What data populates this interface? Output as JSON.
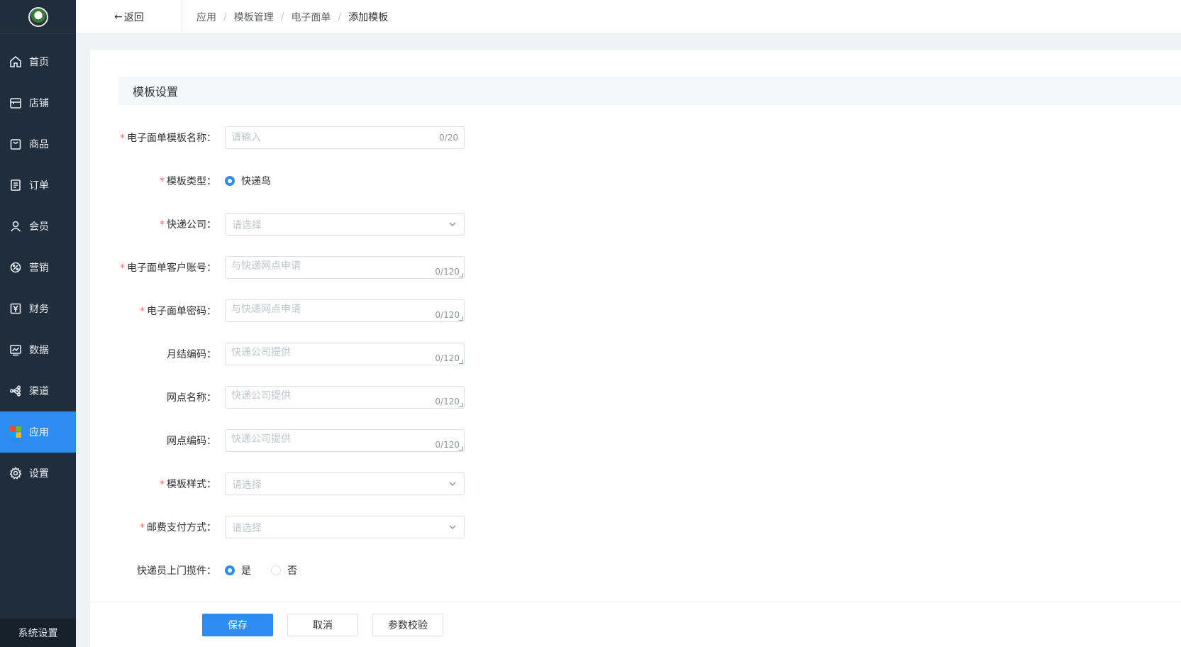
{
  "sidebar": {
    "items": [
      {
        "label": "首页",
        "icon": "home-icon"
      },
      {
        "label": "店铺",
        "icon": "store-icon"
      },
      {
        "label": "商品",
        "icon": "bag-icon"
      },
      {
        "label": "订单",
        "icon": "order-icon"
      },
      {
        "label": "会员",
        "icon": "user-icon"
      },
      {
        "label": "营销",
        "icon": "marketing-icon"
      },
      {
        "label": "财务",
        "icon": "yen-icon"
      },
      {
        "label": "数据",
        "icon": "chart-icon"
      },
      {
        "label": "渠道",
        "icon": "channel-icon"
      },
      {
        "label": "应用",
        "icon": "apps-icon"
      },
      {
        "label": "设置",
        "icon": "gear-icon"
      }
    ],
    "active": "应用",
    "footer_label": "系统设置"
  },
  "header": {
    "back_label": "返回",
    "breadcrumb": [
      "应用",
      "模板管理",
      "电子面单",
      "添加模板"
    ]
  },
  "section_title": "模板设置",
  "form": {
    "template_name": {
      "label": "电子面单模板名称：",
      "placeholder": "请输入",
      "count": "0/20",
      "required": true
    },
    "template_type": {
      "label": "模板类型：",
      "option": "快递鸟",
      "required": true
    },
    "courier": {
      "label": "快递公司：",
      "placeholder": "请选择",
      "required": true
    },
    "customer_account": {
      "label": "电子面单客户账号：",
      "placeholder": "与快递网点申请",
      "count": "0/120",
      "required": true
    },
    "password": {
      "label": "电子面单密码：",
      "placeholder": "与快递网点申请",
      "count": "0/120",
      "required": true
    },
    "monthly_code": {
      "label": "月结编码：",
      "placeholder": "快递公司提供",
      "count": "0/120",
      "required": false
    },
    "outlet_name": {
      "label": "网点名称：",
      "placeholder": "快递公司提供",
      "count": "0/120",
      "required": false
    },
    "outlet_code": {
      "label": "网点编码：",
      "placeholder": "快递公司提供",
      "count": "0/120",
      "required": false
    },
    "template_style": {
      "label": "模板样式：",
      "placeholder": "请选择",
      "required": true
    },
    "postage_payment": {
      "label": "邮费支付方式：",
      "placeholder": "请选择",
      "required": true
    },
    "pickup": {
      "label": "快递员上门揽件：",
      "options": [
        "是",
        "否"
      ],
      "selected": "是",
      "required": false
    }
  },
  "footer": {
    "save_label": "保存",
    "cancel_label": "取消",
    "verify_label": "参数校验"
  },
  "colors": {
    "sidebar_bg": "#1f2d3d",
    "accent": "#2d8cf0",
    "required": "#f56c6c"
  }
}
